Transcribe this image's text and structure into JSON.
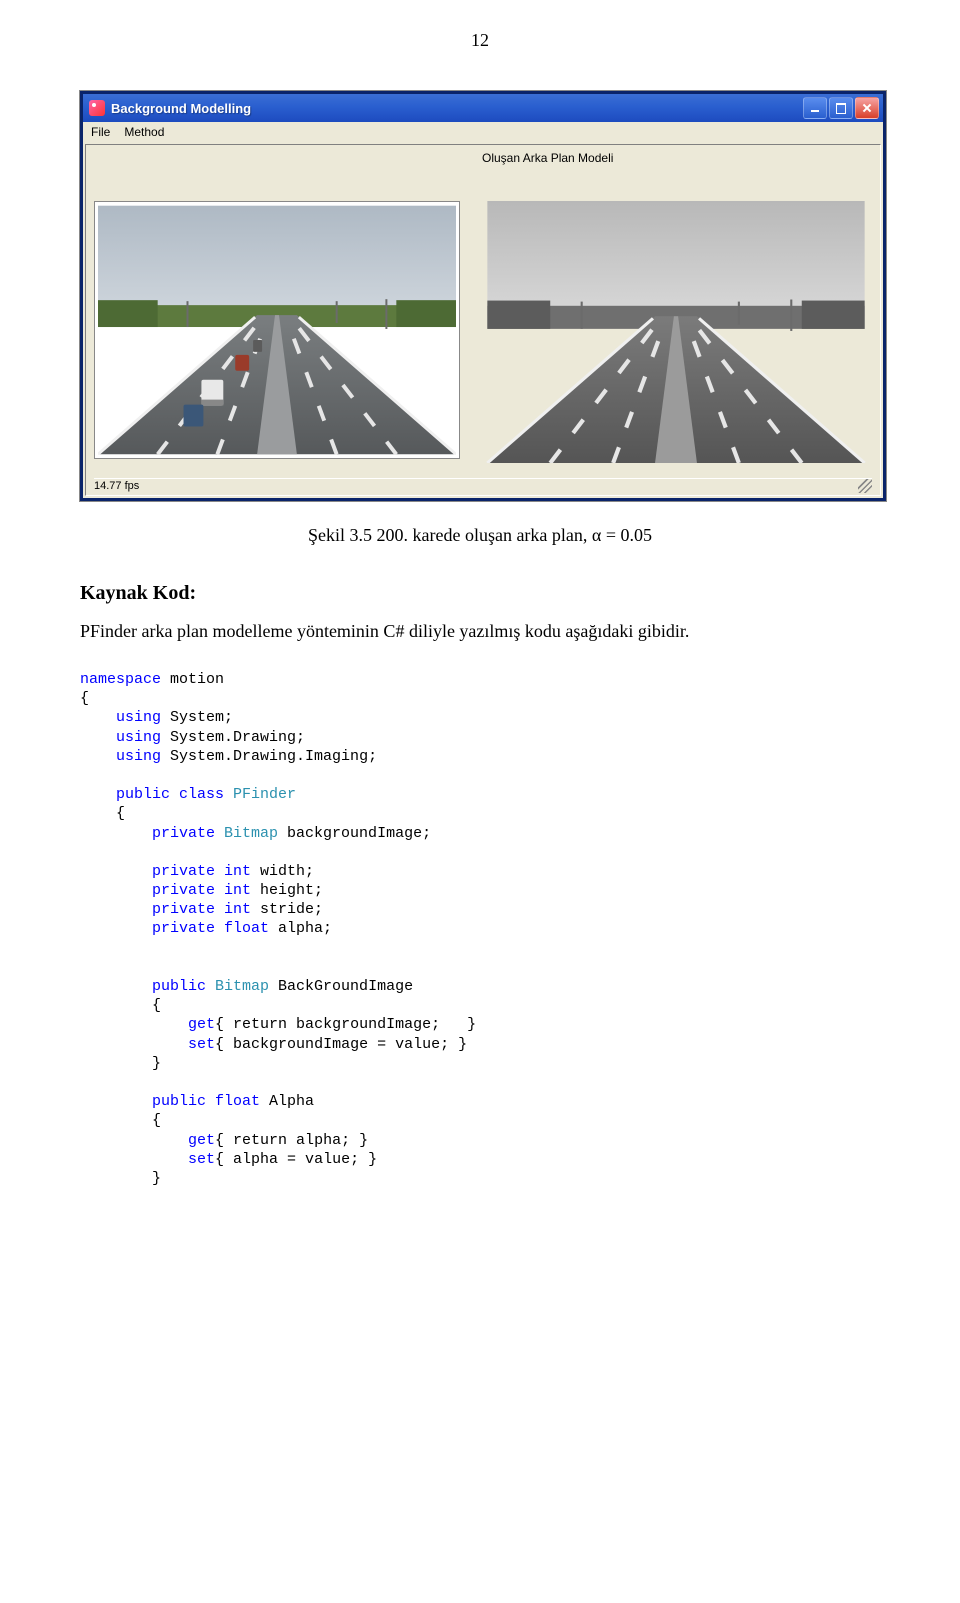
{
  "page_number": "12",
  "window": {
    "title": "Background Modelling",
    "menu": {
      "file": "File",
      "method": "Method"
    },
    "panel_label": "Oluşan Arka Plan Modeli",
    "status_fps": "14.77 fps"
  },
  "caption": "Şekil 3.5 200. karede oluşan arka plan, α = 0.05",
  "subheading": "Kaynak Kod:",
  "body": "PFinder arka plan modelleme yönteminin C# diliyle yazılmış kodu aşağıdaki gibidir.",
  "code": {
    "kw_namespace": "namespace",
    "ns_name": " motion",
    "brace_open": "{",
    "kw_using": "using",
    "sys": " System;",
    "sys_drawing": " System.Drawing;",
    "sys_drawing_imaging": " System.Drawing.Imaging;",
    "kw_public": "public",
    "kw_class": " class",
    "cls_name": " PFinder",
    "kw_private": "private",
    "ty_bitmap": " Bitmap",
    "fld_bg": " backgroundImage;",
    "kw_int": " int",
    "fld_width": " width;",
    "fld_height": " height;",
    "fld_stride": " stride;",
    "kw_float": " float",
    "fld_alpha": " alpha;",
    "prop_bgimage": " BackGroundImage",
    "kw_get": "get",
    "get_bg_body": "{ return backgroundImage;   }",
    "kw_set": "set",
    "set_bg_body": "{ backgroundImage = value; }",
    "prop_alpha": " Alpha",
    "get_alpha_body": "{ return alpha; }",
    "set_alpha_body": "{ alpha = value; }",
    "brace_close": "}"
  }
}
